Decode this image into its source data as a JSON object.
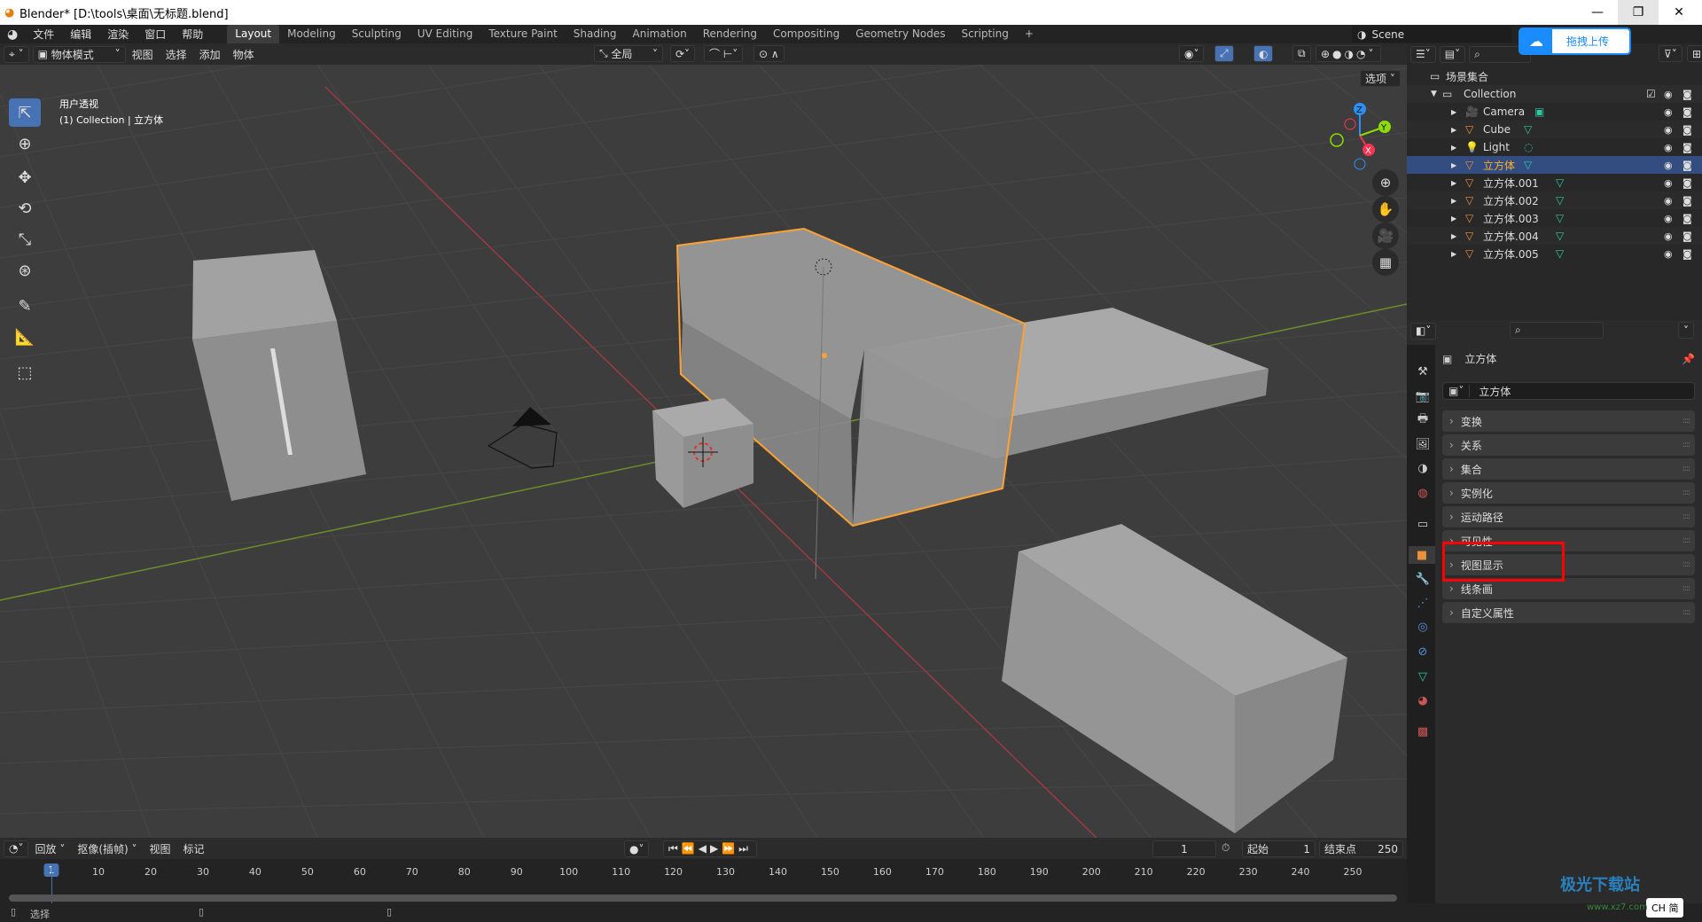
{
  "window": {
    "title": "Blender* [D:\\tools\\桌面\\无标题.blend]",
    "minimize": "—",
    "restore": "❐",
    "close": "✕"
  },
  "topbar": {
    "menus": [
      "文件",
      "编辑",
      "渲染",
      "窗口",
      "帮助"
    ],
    "workspaces": [
      "Layout",
      "Modeling",
      "Sculpting",
      "UV Editing",
      "Texture Paint",
      "Shading",
      "Animation",
      "Rendering",
      "Compositing",
      "Geometry Nodes",
      "Scripting"
    ],
    "active_workspace": "Layout",
    "add_workspace": "+",
    "scene": "Scene",
    "upload_badge": "拖拽上传"
  },
  "viewport_header": {
    "mode": "物体模式",
    "menus": [
      "视图",
      "选择",
      "添加",
      "物体"
    ],
    "transform_orientation": "全局",
    "options": "选项"
  },
  "viewport": {
    "view_name": "用户透视",
    "collection_info": "(1) Collection | 立方体",
    "gizmo_axes": [
      "X",
      "Y",
      "Z"
    ],
    "colors": {
      "selection": "#ffa133",
      "x_axis": "#ff3352",
      "y_axis": "#8bdc00",
      "z_axis": "#2890ff",
      "active_tool": "#4772b3"
    }
  },
  "outliner": {
    "root": "场景集合",
    "collection": "Collection",
    "items": [
      {
        "name": "Camera",
        "type": "camera"
      },
      {
        "name": "Cube",
        "type": "mesh"
      },
      {
        "name": "Light",
        "type": "light"
      },
      {
        "name": "立方体",
        "type": "mesh",
        "selected": true
      },
      {
        "name": "立方体.001",
        "type": "mesh"
      },
      {
        "name": "立方体.002",
        "type": "mesh"
      },
      {
        "name": "立方体.003",
        "type": "mesh"
      },
      {
        "name": "立方体.004",
        "type": "mesh"
      },
      {
        "name": "立方体.005",
        "type": "mesh"
      }
    ]
  },
  "properties": {
    "object_name": "立方体",
    "object_field": "立方体",
    "panels": [
      "变换",
      "关系",
      "集合",
      "实例化",
      "运动路径",
      "可见性",
      "视图显示",
      "线条画",
      "自定义属性"
    ],
    "highlighted_panel": "视图显示"
  },
  "timeline": {
    "menus": [
      "回放",
      "抠像(插帧)",
      "视图",
      "标记"
    ],
    "current_frame": "1",
    "start_label": "起始",
    "start": "1",
    "end_label": "结束点",
    "end": "250",
    "ticks": [
      "1",
      "10",
      "20",
      "30",
      "40",
      "50",
      "60",
      "70",
      "80",
      "90",
      "100",
      "110",
      "120",
      "130",
      "140",
      "150",
      "160",
      "170",
      "180",
      "190",
      "200",
      "210",
      "220",
      "230",
      "240",
      "250"
    ]
  },
  "statusbar": {
    "select": "选择"
  },
  "watermark": {
    "text": "极光下载站",
    "url_text": "www.xz7.com",
    "ime": "CH 简"
  }
}
